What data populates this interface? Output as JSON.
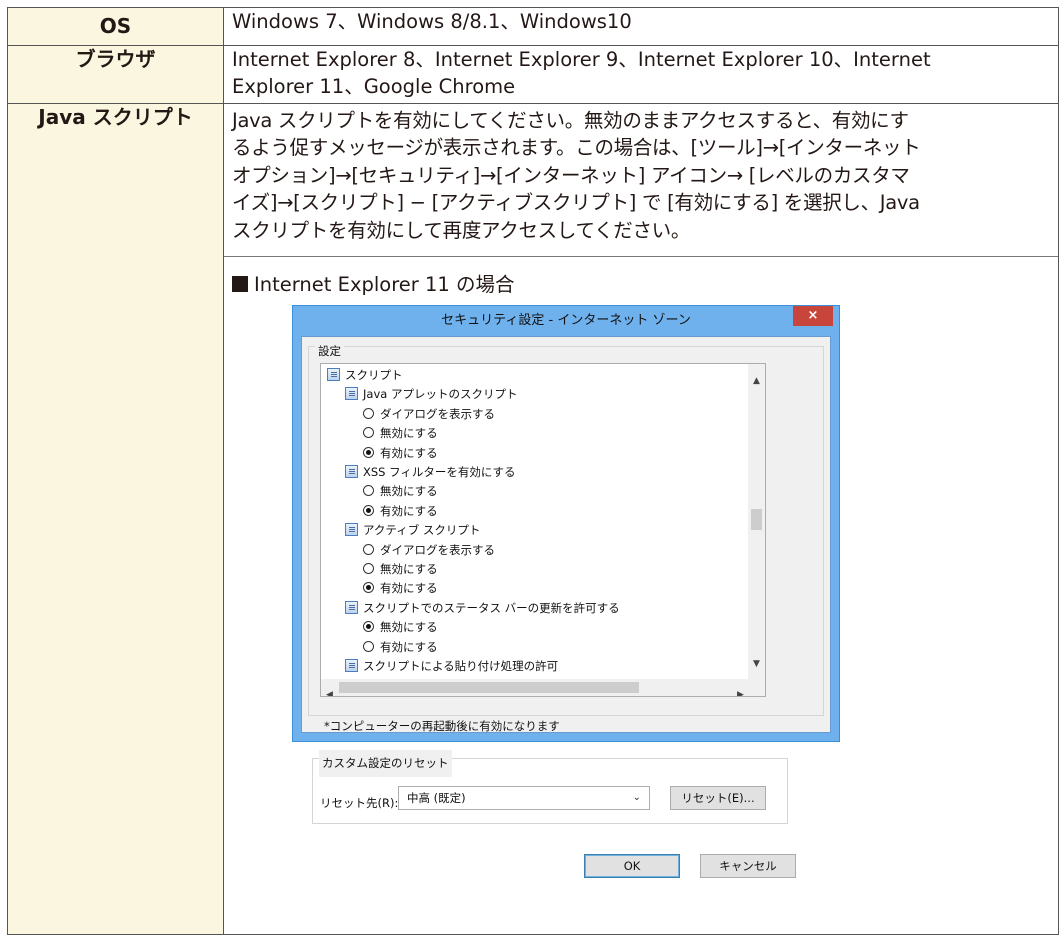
{
  "table": {
    "rows": [
      {
        "label": "OS",
        "value": "Windows 7、Windows 8/8.1、Windows10"
      },
      {
        "label": "ブラウザ",
        "value_lines": [
          "Internet Explorer 8、Internet Explorer 9、Internet Explorer 10、Internet",
          "Explorer 11、Google Chrome"
        ]
      },
      {
        "label": "Java スクリプト",
        "value_lines": [
          "Java スクリプトを有効にしてください。無効のままアクセスすると、有効にす",
          "るよう促すメッセージが表示されます。この場合は、[ツール]→[インターネット",
          "オプション]→[セキュリティ]→[インターネット] アイコン→ [レベルのカスタマ",
          "イズ]→[スクリプト] − [アクティブスクリプト] で [有効にする] を選択し、Java",
          "スクリプトを有効にして再度アクセスしてください。"
        ]
      }
    ],
    "caption": "Internet Explorer 11 の場合"
  },
  "dialog": {
    "title": "セキュリティ設定 - インターネット ゾーン",
    "close_glyph": "×",
    "group_settings": "設定",
    "items": [
      {
        "kind": "page",
        "level": 0,
        "text": "スクリプト"
      },
      {
        "kind": "page",
        "level": 1,
        "text": "Java アプレットのスクリプト"
      },
      {
        "kind": "radio",
        "level": 2,
        "text": "ダイアログを表示する",
        "checked": false
      },
      {
        "kind": "radio",
        "level": 2,
        "text": "無効にする",
        "checked": false
      },
      {
        "kind": "radio",
        "level": 2,
        "text": "有効にする",
        "checked": true
      },
      {
        "kind": "page",
        "level": 1,
        "text": "XSS フィルターを有効にする"
      },
      {
        "kind": "radio",
        "level": 2,
        "text": "無効にする",
        "checked": false
      },
      {
        "kind": "radio",
        "level": 2,
        "text": "有効にする",
        "checked": true
      },
      {
        "kind": "page",
        "level": 1,
        "text": "アクティブ スクリプト"
      },
      {
        "kind": "radio",
        "level": 2,
        "text": "ダイアログを表示する",
        "checked": false
      },
      {
        "kind": "radio",
        "level": 2,
        "text": "無効にする",
        "checked": false
      },
      {
        "kind": "radio",
        "level": 2,
        "text": "有効にする",
        "checked": true
      },
      {
        "kind": "page",
        "level": 1,
        "text": "スクリプトでのステータス バーの更新を許可する"
      },
      {
        "kind": "radio",
        "level": 2,
        "text": "無効にする",
        "checked": true
      },
      {
        "kind": "radio",
        "level": 2,
        "text": "有効にする",
        "checked": false
      },
      {
        "kind": "page",
        "level": 1,
        "text": "スクリプトによる貼り付け処理の許可"
      }
    ],
    "note": "*コンピューターの再起動後に有効になります",
    "group_reset": "カスタム設定のリセット",
    "reset_label": "リセット先(R):",
    "reset_value": "中高 (既定)",
    "reset_button": "リセット(E)...",
    "ok_button": "OK",
    "cancel_button": "キャンセル"
  }
}
